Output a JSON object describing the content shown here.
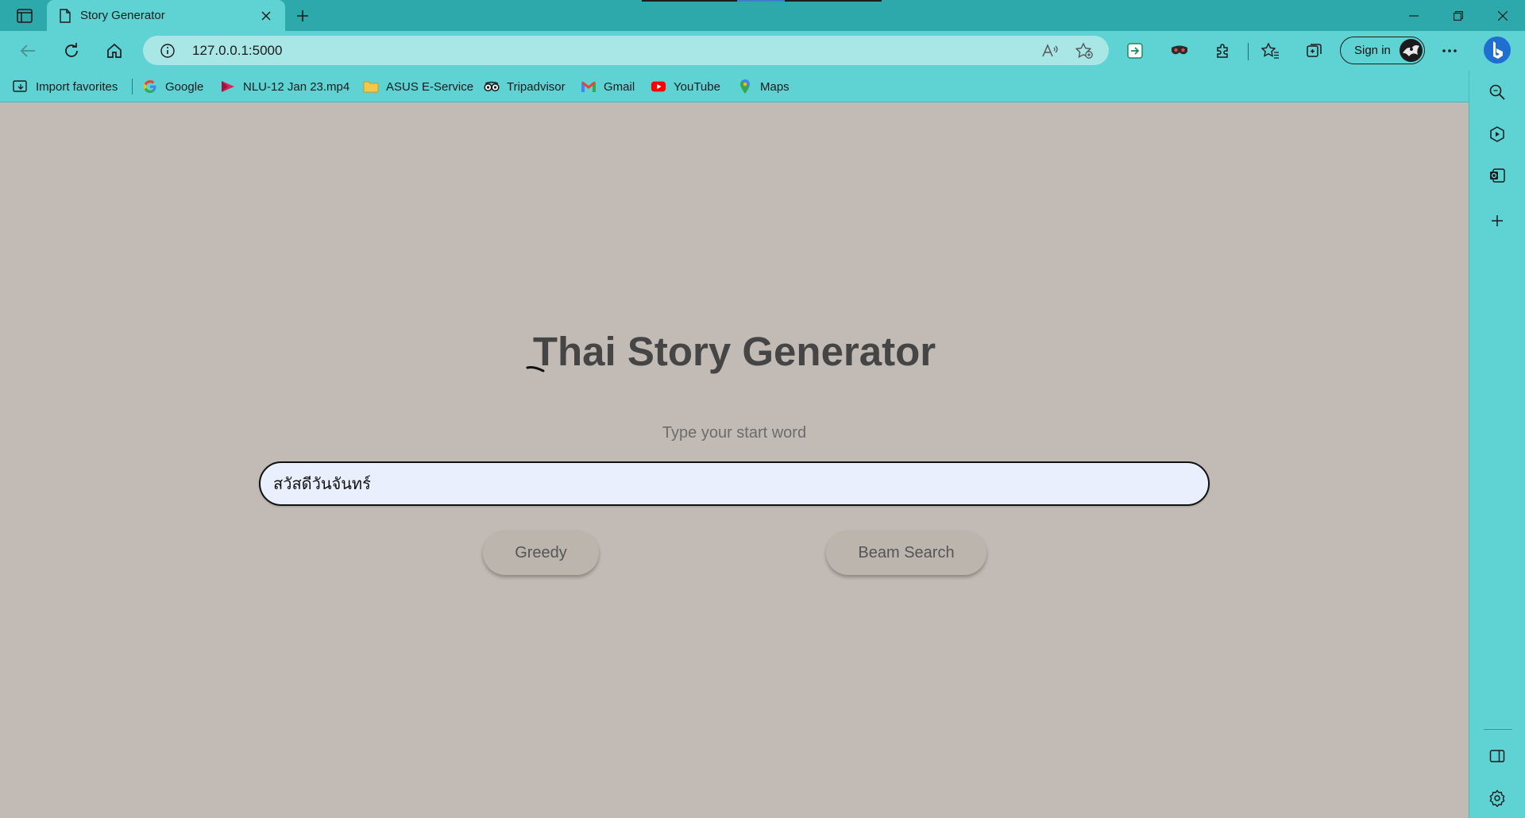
{
  "browser": {
    "tab": {
      "title": "Story Generator",
      "icon": "page-icon"
    },
    "address": {
      "url": "127.0.0.1:5000"
    },
    "toolbar": {
      "signin_label": "Sign in"
    },
    "favorites": [
      {
        "label": "Import favorites",
        "icon": "import-icon"
      },
      {
        "label": "Google",
        "icon": "google-icon"
      },
      {
        "label": "NLU-12 Jan 23.mp4",
        "icon": "video-icon"
      },
      {
        "label": "ASUS E-Service",
        "icon": "folder-icon"
      },
      {
        "label": "Tripadvisor",
        "icon": "tripadvisor-icon"
      },
      {
        "label": "Gmail",
        "icon": "gmail-icon"
      },
      {
        "label": "YouTube",
        "icon": "youtube-icon"
      },
      {
        "label": "Maps",
        "icon": "maps-icon"
      }
    ]
  },
  "app": {
    "title": "Thai Story Generator",
    "prompt": "Type your start word",
    "input_value": "สวัสดีวันจันทร์",
    "buttons": {
      "greedy": "Greedy",
      "beam": "Beam Search"
    }
  },
  "colors": {
    "chrome": "#5fd3d3",
    "titlebar": "#2ea9ab",
    "page_bg": "#c2bbb5",
    "heading": "#454545",
    "input_bg": "#e9effc"
  }
}
